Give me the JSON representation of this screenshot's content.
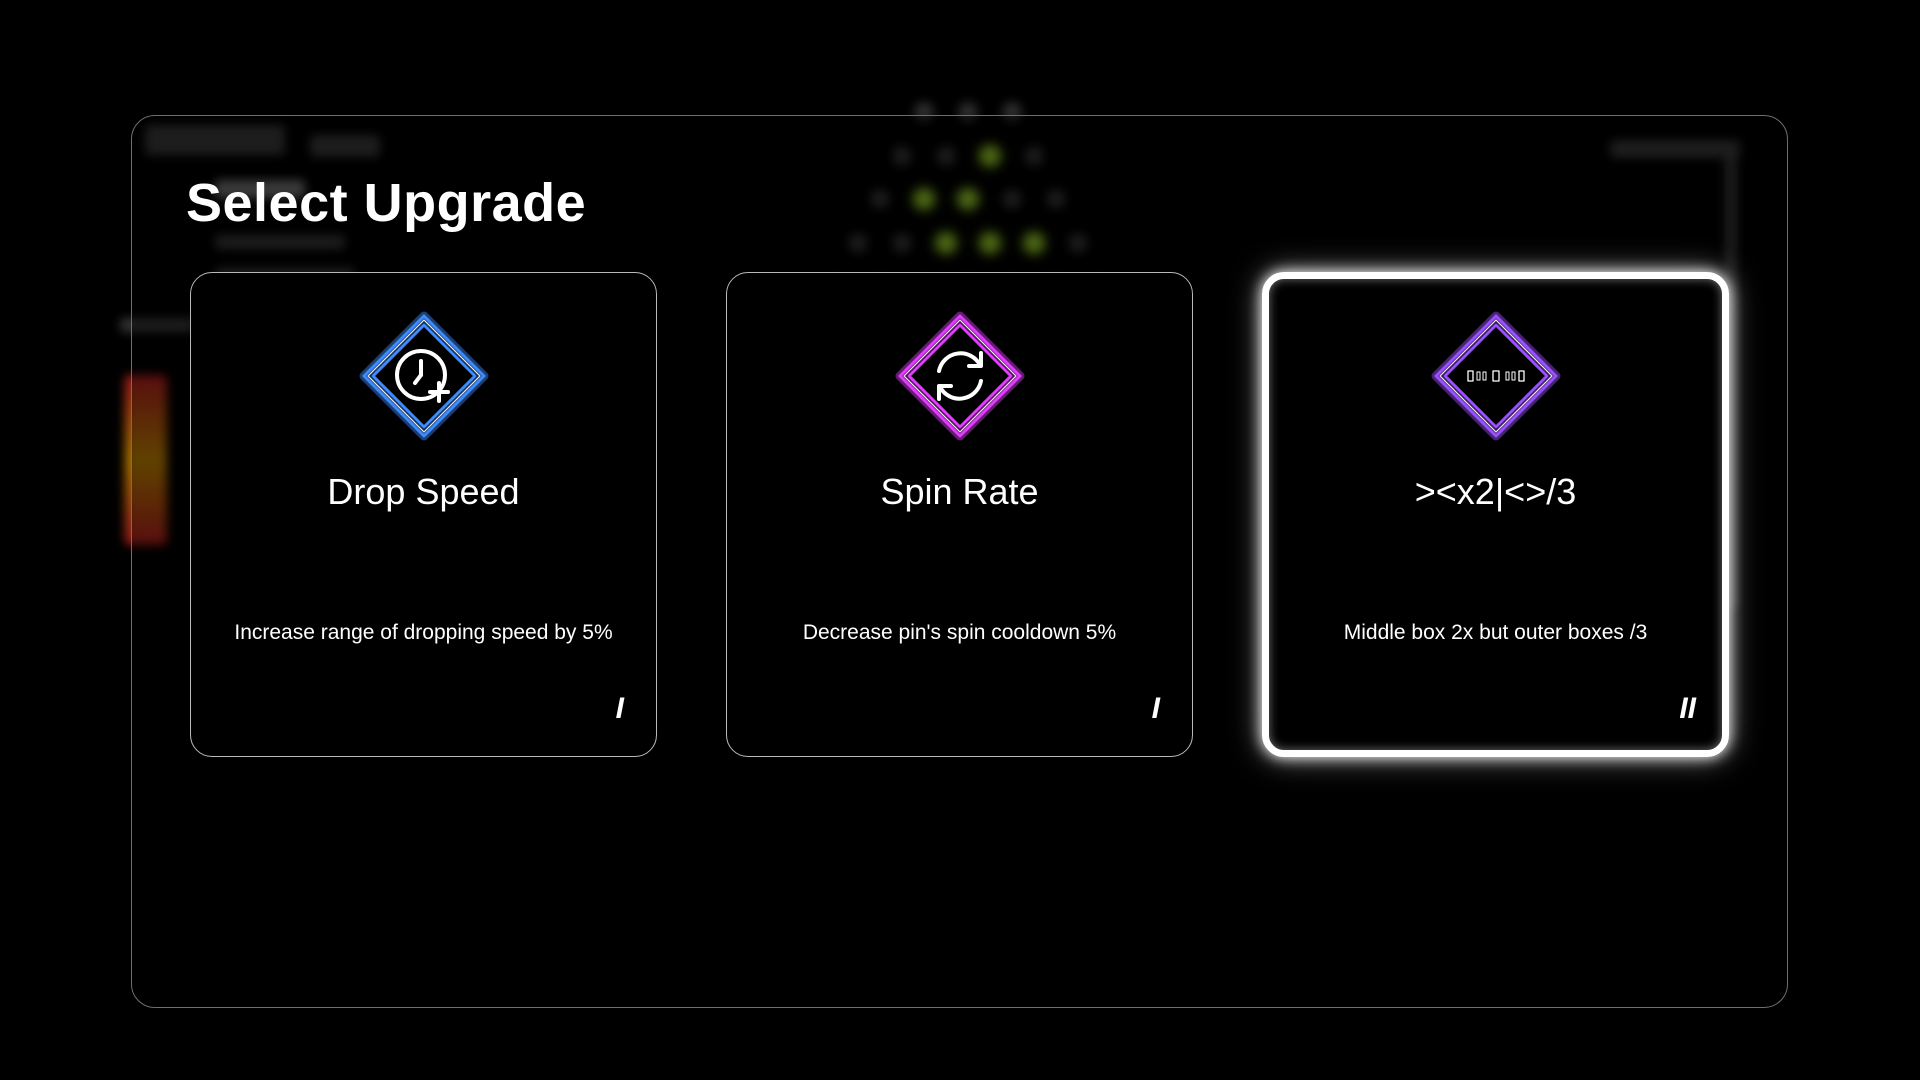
{
  "screen": {
    "title": "Select Upgrade"
  },
  "cards": [
    {
      "name": "Drop Speed",
      "description": "Increase range of dropping speed by 5%",
      "tier": "I",
      "icon": "clock-plus-icon",
      "accent": "#3d8bff",
      "selected": false
    },
    {
      "name": "Spin Rate",
      "description": "Decrease pin's spin cooldown 5%",
      "tier": "I",
      "icon": "refresh-icon",
      "accent": "#e23cff",
      "selected": false
    },
    {
      "name": "><x2|<>/3",
      "description": "Middle box 2x but outer boxes /3",
      "tier": "II",
      "icon": "boxes-icon",
      "accent": "#9a50ff",
      "selected": true
    }
  ],
  "colors": {
    "lit_peg": "#a6e22e",
    "panel_border": "#6e6e6e",
    "card_border": "#b9b9b9"
  }
}
